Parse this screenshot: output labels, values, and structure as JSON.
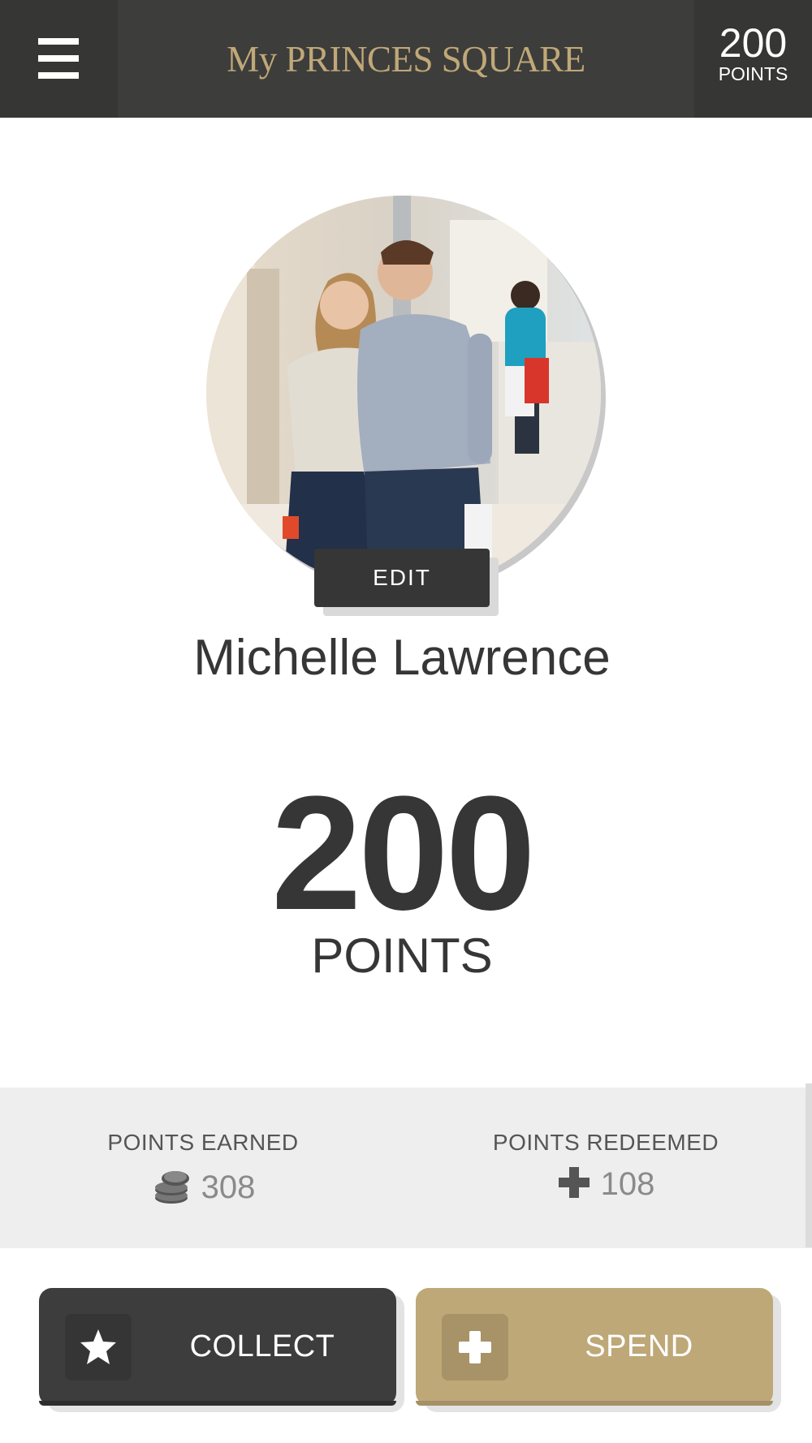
{
  "header": {
    "brand": "My PRINCES SQUARE",
    "points_value": "200",
    "points_label": "POINTS"
  },
  "profile": {
    "edit_label": "EDIT",
    "name": "Michelle Lawrence",
    "points_value": "200",
    "points_label": "POINTS"
  },
  "stats": {
    "earned_label": "POINTS EARNED",
    "earned_value": "308",
    "earned_icon": "coins-icon",
    "redeemed_label": "POINTS REDEEMED",
    "redeemed_value": "108",
    "redeemed_icon": "plus-icon"
  },
  "actions": {
    "collect_label": "COLLECT",
    "collect_icon": "star-icon",
    "spend_label": "SPEND",
    "spend_icon": "plus-icon"
  },
  "colors": {
    "header_bg": "#3d3d3b",
    "brand_gold": "#c0a878",
    "dark": "#363636",
    "spend_bg": "#bea878",
    "stats_bg": "#eeeeee"
  }
}
